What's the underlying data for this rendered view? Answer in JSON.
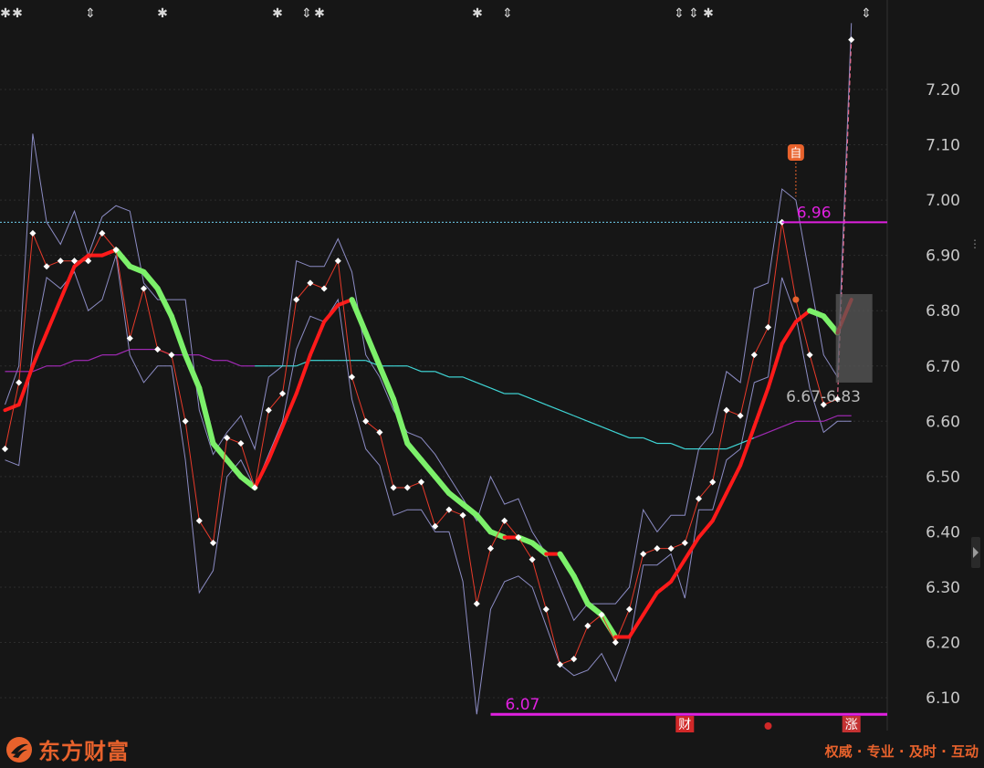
{
  "colors": {
    "background": "#161616",
    "grid": "#2c2c2c",
    "up_line": "#ff1a1a",
    "down_line": "#7cf06a",
    "price_line": "#e83a2a",
    "band": "#8c8cc4",
    "ma_cyan": "#3fd6d6",
    "ma_purple": "#a02ab4",
    "magenta": "#e020e0",
    "brand": "#e8622c"
  },
  "chart_data": {
    "type": "line",
    "ylim": [
      6.05,
      7.32
    ],
    "y_ticks": [
      "7.20",
      "7.10",
      "7.00",
      "6.90",
      "6.80",
      "6.70",
      "6.60",
      "6.50",
      "6.40",
      "6.30",
      "6.20",
      "6.10"
    ],
    "y_tick_values": [
      7.2,
      7.1,
      7.0,
      6.9,
      6.8,
      6.7,
      6.6,
      6.5,
      6.4,
      6.3,
      6.2,
      6.1
    ],
    "points": 63,
    "grid": true,
    "series": [
      {
        "role": "price",
        "values": [
          6.55,
          6.67,
          6.94,
          6.88,
          6.89,
          6.89,
          6.89,
          6.94,
          6.91,
          6.75,
          6.84,
          6.73,
          6.72,
          6.6,
          6.42,
          6.38,
          6.57,
          6.56,
          6.48,
          6.62,
          6.65,
          6.82,
          6.85,
          6.84,
          6.89,
          6.68,
          6.6,
          6.58,
          6.48,
          6.48,
          6.49,
          6.41,
          6.44,
          6.43,
          6.27,
          6.37,
          6.42,
          6.39,
          6.35,
          6.26,
          6.16,
          6.17,
          6.23,
          6.25,
          6.2,
          6.26,
          6.36,
          6.37,
          6.37,
          6.38,
          6.46,
          6.49,
          6.62,
          6.61,
          6.72,
          6.77,
          6.96,
          6.82,
          6.72,
          6.63,
          6.64,
          7.29
        ]
      },
      {
        "role": "band_upper",
        "values": [
          6.63,
          6.7,
          7.12,
          6.96,
          6.92,
          6.98,
          6.9,
          6.97,
          6.99,
          6.98,
          6.85,
          6.82,
          6.82,
          6.82,
          6.62,
          6.54,
          6.58,
          6.61,
          6.55,
          6.68,
          6.7,
          6.89,
          6.88,
          6.88,
          6.93,
          6.87,
          6.72,
          6.68,
          6.62,
          6.58,
          6.57,
          6.54,
          6.5,
          6.46,
          6.42,
          6.5,
          6.45,
          6.46,
          6.4,
          6.36,
          6.3,
          6.24,
          6.27,
          6.27,
          6.27,
          6.3,
          6.44,
          6.4,
          6.43,
          6.43,
          6.55,
          6.58,
          6.69,
          6.67,
          6.84,
          6.85,
          7.02,
          7.0,
          6.86,
          6.72,
          6.68,
          7.32
        ]
      },
      {
        "role": "band_lower",
        "values": [
          6.53,
          6.52,
          6.73,
          6.86,
          6.84,
          6.87,
          6.8,
          6.82,
          6.9,
          6.72,
          6.67,
          6.7,
          6.7,
          6.53,
          6.29,
          6.33,
          6.5,
          6.53,
          6.48,
          6.54,
          6.6,
          6.73,
          6.79,
          6.78,
          6.82,
          6.64,
          6.55,
          6.52,
          6.43,
          6.44,
          6.44,
          6.4,
          6.4,
          6.31,
          6.07,
          6.26,
          6.31,
          6.32,
          6.3,
          6.23,
          6.16,
          6.14,
          6.15,
          6.18,
          6.13,
          6.2,
          6.34,
          6.34,
          6.36,
          6.28,
          6.44,
          6.44,
          6.53,
          6.55,
          6.67,
          6.68,
          6.86,
          6.79,
          6.66,
          6.58,
          6.6,
          6.6
        ]
      },
      {
        "role": "trend",
        "values": [
          6.62,
          6.63,
          6.7,
          6.76,
          6.82,
          6.88,
          6.9,
          6.9,
          6.91,
          6.88,
          6.87,
          6.84,
          6.79,
          6.72,
          6.66,
          6.56,
          6.53,
          6.5,
          6.48,
          6.53,
          6.59,
          6.65,
          6.72,
          6.78,
          6.81,
          6.82,
          6.76,
          6.7,
          6.64,
          6.56,
          6.53,
          6.5,
          6.47,
          6.45,
          6.43,
          6.4,
          6.39,
          6.39,
          6.38,
          6.36,
          6.36,
          6.32,
          6.27,
          6.25,
          6.21,
          6.21,
          6.25,
          6.29,
          6.31,
          6.35,
          6.39,
          6.42,
          6.47,
          6.52,
          6.59,
          6.66,
          6.74,
          6.78,
          6.8,
          6.79,
          6.76,
          6.82
        ]
      },
      {
        "role": "ma_long",
        "values": [
          6.69,
          6.69,
          6.69,
          6.7,
          6.7,
          6.71,
          6.71,
          6.72,
          6.72,
          6.73,
          6.73,
          6.73,
          6.72,
          6.72,
          6.72,
          6.71,
          6.71,
          6.7,
          6.7,
          6.7,
          6.7,
          6.7,
          6.71,
          6.71,
          6.71,
          6.71,
          6.71,
          6.7,
          6.7,
          6.7,
          6.69,
          6.69,
          6.68,
          6.68,
          6.67,
          6.66,
          6.65,
          6.65,
          6.64,
          6.63,
          6.62,
          6.61,
          6.6,
          6.59,
          6.58,
          6.57,
          6.57,
          6.56,
          6.56,
          6.55,
          6.55,
          6.55,
          6.55,
          6.56,
          6.57,
          6.58,
          6.59,
          6.6,
          6.6,
          6.6,
          6.61,
          6.61
        ]
      }
    ]
  },
  "annotations": {
    "high_label": "6.96",
    "low_label": "6.07",
    "range_label": "6.67-6.83",
    "self_marker": "自",
    "fin_marker": "财",
    "zhang_marker": "涨",
    "star_glyph": "✱",
    "arrow_glyph": "⇕"
  },
  "branding": {
    "logo_text": "东方财富",
    "slogan": "权威 · 专业 · 及时 · 互动",
    "logo_icon": "eastmoney-logo-icon"
  }
}
